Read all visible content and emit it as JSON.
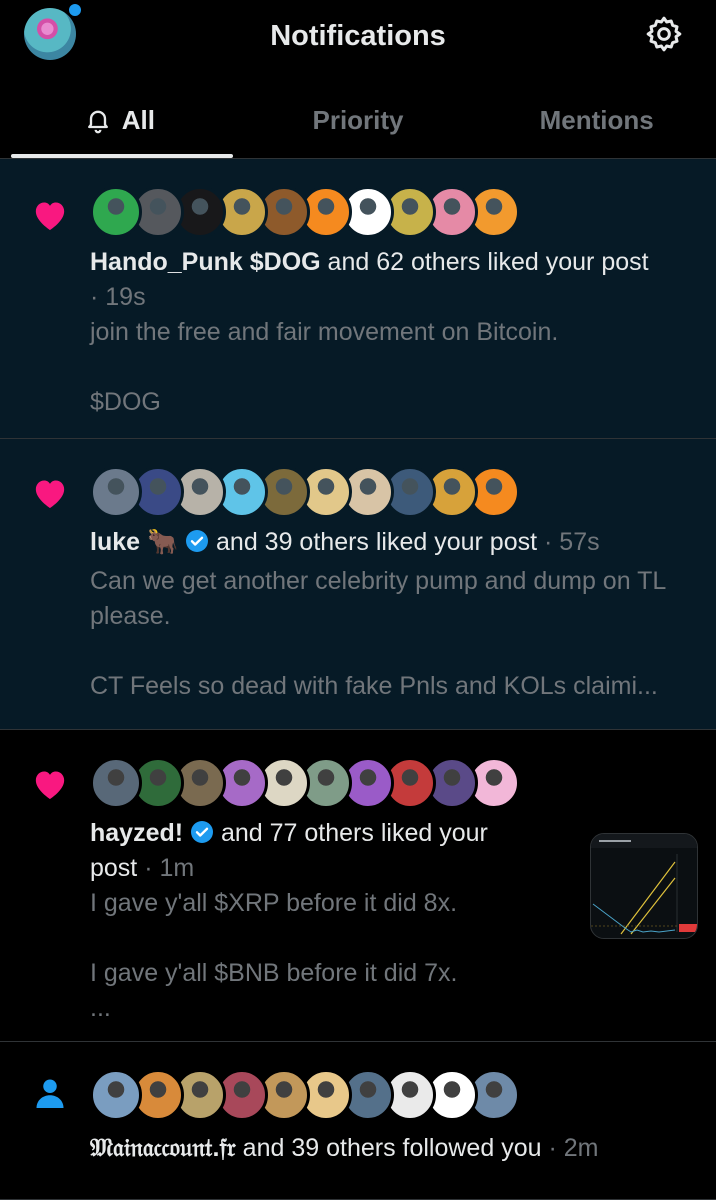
{
  "header": {
    "title": "Notifications"
  },
  "tabs": [
    {
      "label": "All"
    },
    {
      "label": "Priority"
    },
    {
      "label": "Mentions"
    }
  ],
  "colors": {
    "accent": "#1d9bf0",
    "like": "#f91880",
    "unread_bg": "#061a26",
    "muted": "#71767b"
  },
  "notifications": [
    {
      "kind_icon": "heart-icon",
      "avatar_colors": [
        "#2fa84f",
        "#55585d",
        "#18181a",
        "#c9a64a",
        "#8e5a2b",
        "#f58a1f",
        "#ffffff",
        "#c7b24a",
        "#e58aa6",
        "#f29a2e"
      ],
      "user": "Hando_Punk $DOG",
      "action": " and 62 others liked your post",
      "time": "· 19s",
      "snippet": "join the free and fair movement on Bitcoin.\n\n$DOG"
    },
    {
      "kind_icon": "heart-icon",
      "avatar_colors": [
        "#6b7a8c",
        "#3a4a86",
        "#b7b2a8",
        "#5fc4e8",
        "#7c6a3b",
        "#e2c88a",
        "#d8c4a6",
        "#3d5a7a",
        "#d7a23a",
        "#f58a1f"
      ],
      "user": "luke",
      "emoji": "🐂",
      "action": " and 39 others liked your post",
      "time": "· 57s",
      "snippet": "Can we get another celebrity pump and dump on TL please.\n\nCT Feels so dead with fake Pnls and KOLs claimi..."
    },
    {
      "kind_icon": "heart-icon",
      "avatar_colors": [
        "#586878",
        "#2f6b3a",
        "#7a6a50",
        "#a66ac7",
        "#ddd7c4",
        "#7f9c88",
        "#9a5bc8",
        "#c43b3b",
        "#5a4a88",
        "#f2b7d8"
      ],
      "user": "hayzed!",
      "action": " and 77 others liked your",
      "action2": "post",
      "time": "· 1m",
      "snippet": "I gave y'all $XRP before it did 8x.\n\nI gave y'all $BNB before it did 7x.\n..."
    },
    {
      "kind_icon": "person-icon",
      "avatar_colors": [
        "#7a9dc0",
        "#d88a3a",
        "#b8a26a",
        "#a8485a",
        "#c2985a",
        "#e8c88a",
        "#54708a",
        "#eaeaea",
        "#ffffff",
        "#6e8aa8"
      ],
      "user": "𝔐𝔞𝔦𝔫𝔞𝔠𝔠𝔬𝔲𝔫𝔱.𝔣𝔯",
      "action": " and 39 others followed you",
      "time": "· 2m"
    }
  ]
}
